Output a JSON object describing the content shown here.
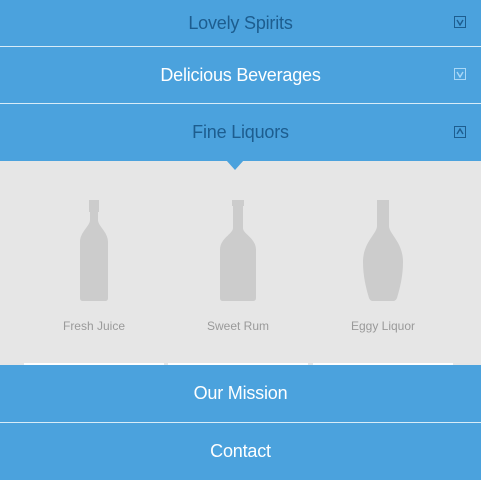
{
  "menu": {
    "items": [
      {
        "label": "Lovely Spirits",
        "toggle": "down"
      },
      {
        "label": "Delicious Beverages",
        "toggle": "down"
      },
      {
        "label": "Fine Liquors",
        "toggle": "up",
        "expanded": true
      }
    ],
    "bottom_items": [
      {
        "label": "Our Mission"
      },
      {
        "label": "Contact"
      }
    ]
  },
  "products": [
    {
      "label": "Fresh Juice",
      "icon": "juice-bottle-icon"
    },
    {
      "label": "Sweet Rum",
      "icon": "rum-bottle-icon"
    },
    {
      "label": "Eggy Liquor",
      "icon": "liquor-bottle-icon"
    }
  ],
  "colors": {
    "bar": "#4ba2dd",
    "label_dark": "#1d5d8f",
    "label_light": "#ffffff",
    "panel": "#e6e6e6",
    "bottle": "#cccccc",
    "product_label": "#9a9a9a"
  }
}
